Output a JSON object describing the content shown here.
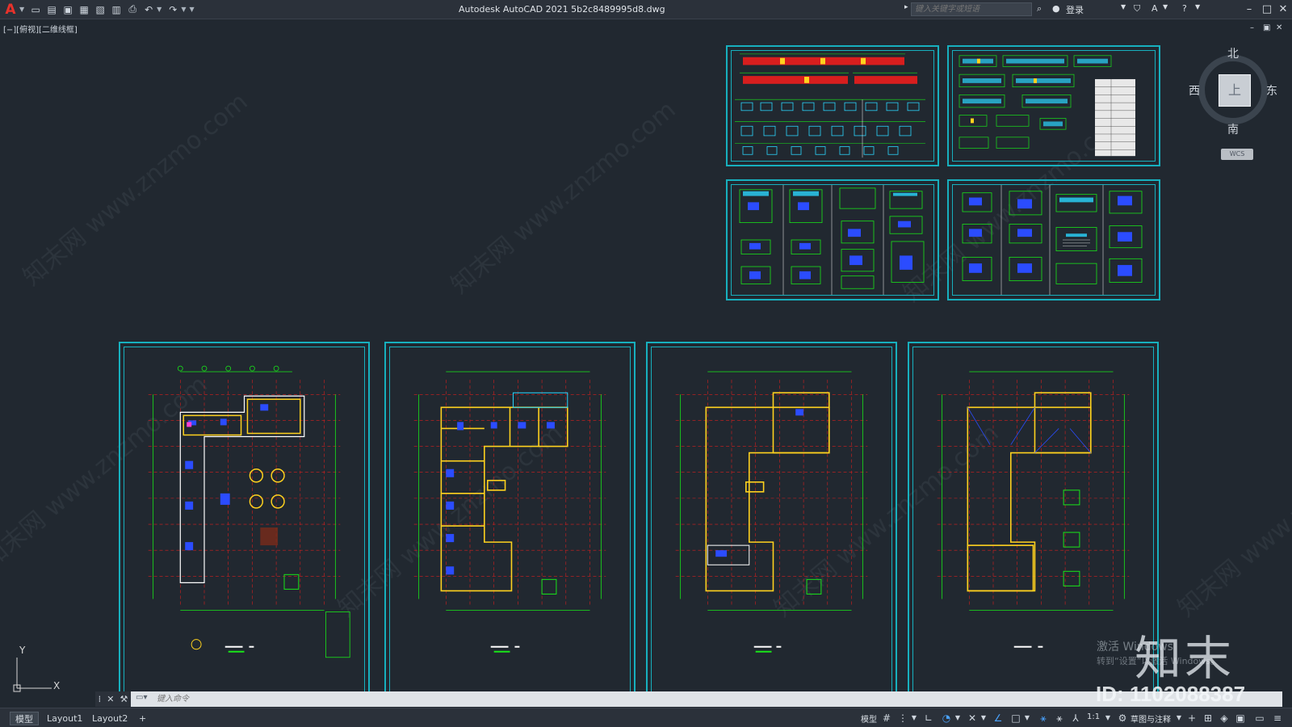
{
  "titlebar": {
    "app_logo": "A",
    "title": "Autodesk AutoCAD 2021    5b2c8489995d8.dwg",
    "search_placeholder": "键入关键字或短语",
    "login_label": "登录",
    "quick_access_icons": [
      "new-icon",
      "open-icon",
      "save-icon",
      "save-as-icon",
      "plot-preview-icon",
      "publish-icon",
      "print-icon",
      "undo-icon",
      "redo-icon"
    ]
  },
  "viewport": {
    "label": "[−][俯视][二维线框]"
  },
  "viewcube": {
    "face": "上",
    "north": "北",
    "south": "南",
    "west": "西",
    "east": "东",
    "wcs": "WCS"
  },
  "ucs": {
    "x_label": "X",
    "y_label": "Y"
  },
  "cmdline": {
    "placeholder": "键入命令"
  },
  "statusbar": {
    "tabs": [
      "模型",
      "Layout1",
      "Layout2"
    ],
    "add_tab": "+",
    "model_label": "模型",
    "scale": "1:1",
    "workspace": "草图与注释"
  },
  "watermark": {
    "site": "知末网 www.znzmo.com",
    "logo": "知末",
    "id": "ID: 1102088387",
    "activate_title": "激活 Windows",
    "activate_sub": "转到“设置”以激活 Windows。"
  },
  "colors": {
    "background": "#212830",
    "sheet_border": "#17b0be",
    "wall": "#ffd21e",
    "axis_green": "#19e619",
    "grid_red": "#d81e1e",
    "blue_detail": "#2b4cff"
  }
}
